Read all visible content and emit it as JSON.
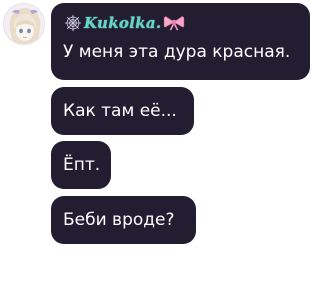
{
  "chat": {
    "author": {
      "name": "Kukolka.",
      "name_color": "#5fd8c8",
      "badge_left": "spider-web-icon",
      "badge_right": "pink-bow-icon"
    },
    "bubble_color": "#221d31",
    "messages": [
      {
        "text": "У меня эта дура красная."
      },
      {
        "text": "Как там её..."
      },
      {
        "text": "Ёпт."
      },
      {
        "text": "Беби вроде?"
      }
    ]
  }
}
